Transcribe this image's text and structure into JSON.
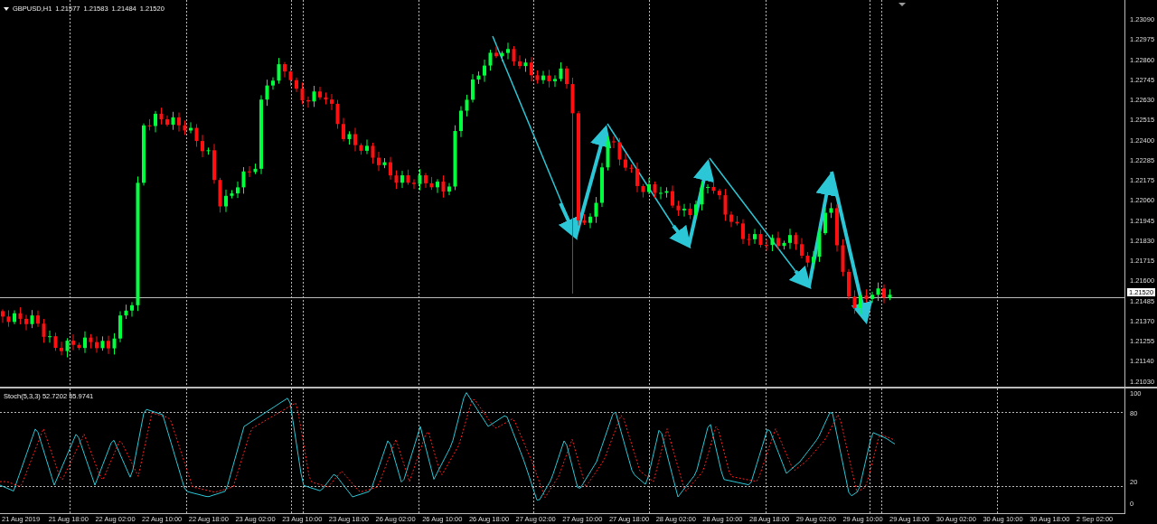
{
  "header": {
    "symbol": "GBPUSD,H1",
    "quotes": [
      "1.21577",
      "1.21583",
      "1.21484",
      "1.21520"
    ]
  },
  "price_axis": {
    "labels": [
      "1.23090",
      "1.22975",
      "1.22860",
      "1.22745",
      "1.22630",
      "1.22515",
      "1.22400",
      "1.22285",
      "1.22175",
      "1.22060",
      "1.21945",
      "1.21830",
      "1.21715",
      "1.21600",
      "1.21485",
      "1.21370",
      "1.21255",
      "1.21140",
      "1.21030"
    ],
    "current_price": "1.21520"
  },
  "indicator": {
    "label": "Stoch(5,3,3) 52.7202 55.9741",
    "axis_labels": [
      "100",
      "80",
      "20",
      "0"
    ]
  },
  "time_axis": {
    "labels": [
      "21 Aug 2019",
      "21 Aug 18:00",
      "22 Aug 02:00",
      "22 Aug 10:00",
      "22 Aug 18:00",
      "23 Aug 02:00",
      "23 Aug 10:00",
      "23 Aug 18:00",
      "26 Aug 02:00",
      "26 Aug 10:00",
      "26 Aug 18:00",
      "27 Aug 02:00",
      "27 Aug 10:00",
      "27 Aug 18:00",
      "28 Aug 02:00",
      "28 Aug 10:00",
      "28 Aug 18:00",
      "29 Aug 02:00",
      "29 Aug 10:00",
      "29 Aug 18:00",
      "30 Aug 02:00",
      "30 Aug 10:00",
      "30 Aug 18:00",
      "2 Sep 02:00"
    ]
  }
}
